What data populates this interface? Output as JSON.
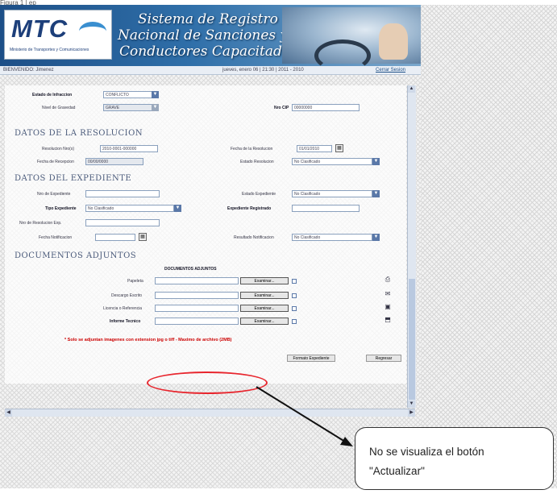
{
  "doc_label": "Figura 1 | ep",
  "header": {
    "logo": "MTC",
    "logo_sub": "Ministerio de Transportes y Comunicaciones",
    "title_lines": [
      "Sistema de Registro",
      "Nacional de Sanciones y",
      "Conductores Capacitados"
    ]
  },
  "infobar": {
    "user": "BIENVENIDO: Jimenez",
    "date": "jueves, enero 06 | 21:30 | 2011 - 2010",
    "logout": "Cerrar Sesion"
  },
  "form": {
    "top": {
      "estado_infraccion_label": "Estado de Infraccion",
      "estado_infraccion_value": "CONFLICTO",
      "nivel_gravedad_label": "Nivel de Gravedad",
      "nivel_gravedad_value": "GRAVE",
      "nro_cip_label": "Nro CIP",
      "nro_cip_value": "00000000"
    },
    "resolucion": {
      "title": "DATOS DE LA RESOLUCION",
      "nro_resolucion_label": "Resolucion Nro(s)",
      "nro_resolucion_value": "2010-0001-000000",
      "fecha_resolucion_label": "Fecha de la Resolucion",
      "fecha_resolucion_value": "01/01/2010",
      "fecha_recepcion_label": "Fecha de Recepcion",
      "fecha_recepcion_value": "00/00/0000",
      "estado_resolucion_label": "Estado Resolucion",
      "estado_resolucion_value": "No Clasificado"
    },
    "expediente": {
      "title": "DATOS DEL EXPEDIENTE",
      "nro_expediente_label": "Nro de Expediente",
      "estado_expediente_label": "Estado Expediente",
      "estado_expediente_value": "No Clasificado",
      "tipo_expediente_label": "Tipo Expediente",
      "tipo_expediente_value": "No Clasificado",
      "expediente_registrado_label": "Expediente Registrado",
      "nro_resolucion_exp_label": "Nro de Resolucion Exp.",
      "fecha_notificacion_label": "Fecha Notificacion",
      "resultado_notificacion_label": "Resultado Notificacion",
      "resultado_notificacion_value": "No Clasificado"
    },
    "documentos": {
      "title": "DOCUMENTOS ADJUNTOS",
      "subtitle": "DOCUMENTOS ADJUNTOS",
      "rows": [
        {
          "label": "Papeleta",
          "button": "Examinar..."
        },
        {
          "label": "Descargo Escrito",
          "button": "Examinar..."
        },
        {
          "label": "Licencia o Referencia",
          "button": "Examinar..."
        },
        {
          "label": "Informe Tecnico",
          "button": "Examinar..."
        }
      ],
      "warning": "* Solo se adjuntan imagenes con extension jpg o tiff - Maximo de archivo (2MB)"
    },
    "buttons": {
      "primary": "Formato Expediente",
      "back": "Regresar"
    }
  },
  "callout": {
    "line1": "No se visualiza el botón",
    "line2": "\"Actualizar\""
  },
  "colors": {
    "banner": "#2f6fa9",
    "highlight": "#e8262e",
    "warning": "#cc0000"
  }
}
